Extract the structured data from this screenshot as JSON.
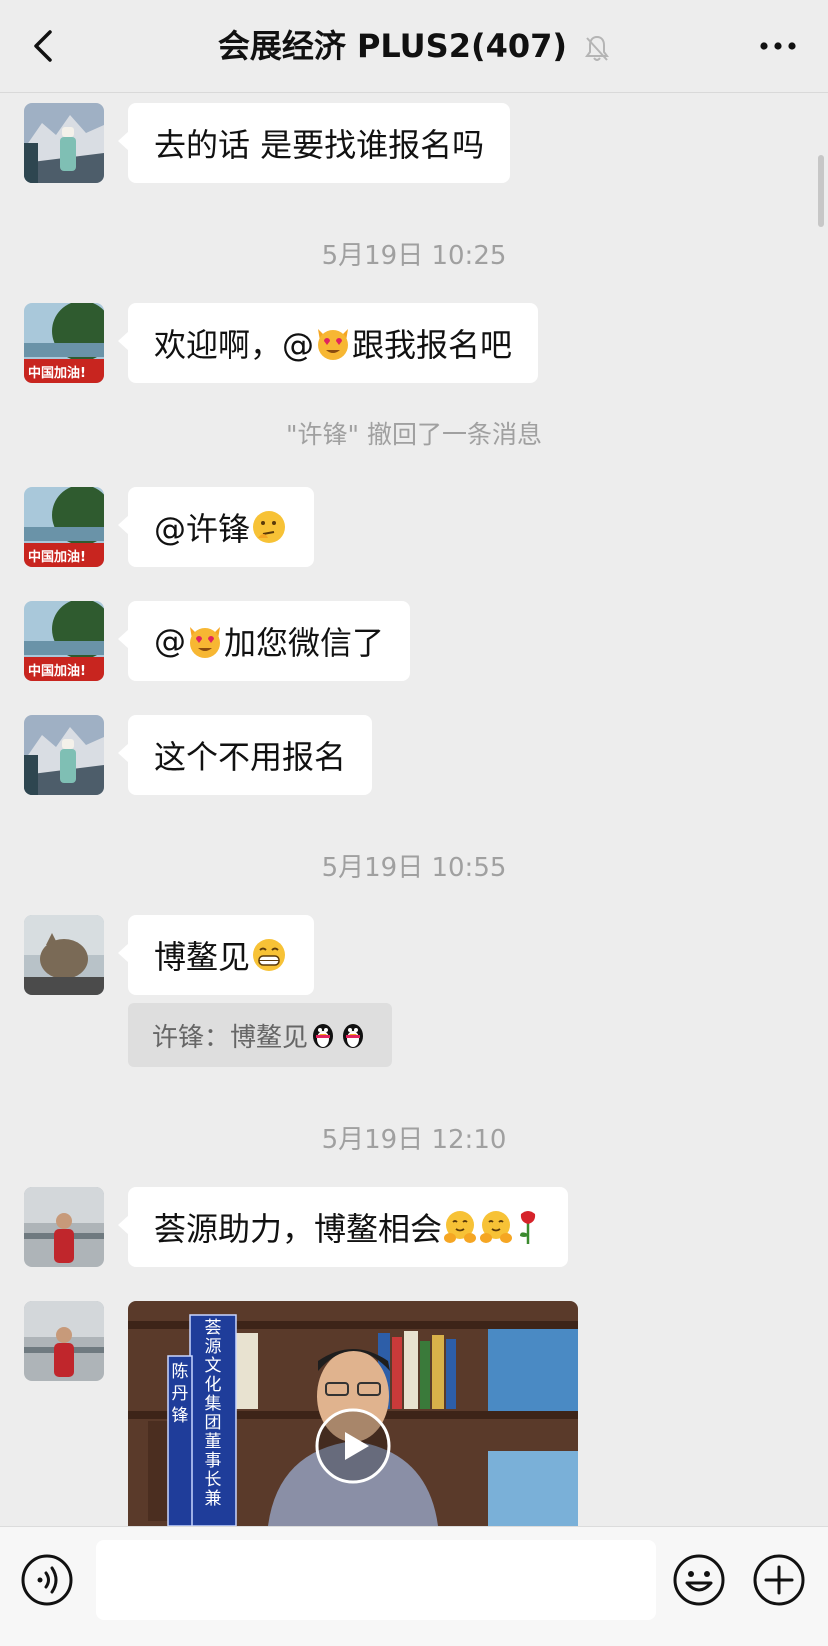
{
  "header": {
    "title": "会展经济 PLUS2(407)",
    "back_icon": "chevron-left-icon",
    "mute_icon": "bell-muted-icon",
    "more_icon": "more-icon"
  },
  "messages": [
    {
      "text": "去的话 是要找谁报名吗"
    },
    {
      "text_a": "欢迎啊，@",
      "text_b": " 跟我报名吧"
    },
    {
      "text": "@许锋 "
    },
    {
      "text_a": "@",
      "text_b": " 加您微信了"
    },
    {
      "text": "这个不用报名"
    },
    {
      "text": "博鳌见"
    },
    {
      "text": "荟源助力，博鳌相会"
    }
  ],
  "timestamps": [
    "5月19日 10:25",
    "5月19日 10:55",
    "5月19日 12:10"
  ],
  "system": {
    "recall": "\"许锋\" 撤回了一条消息"
  },
  "quote": {
    "text": "许锋：博鳌见"
  },
  "video": {
    "banner_main": [
      "荟",
      "源",
      "文",
      "化",
      "集",
      "团",
      "董",
      "事",
      "长",
      "兼"
    ],
    "banner_name": [
      "陈",
      "丹",
      "锋"
    ],
    "play_icon": "play-icon"
  },
  "input": {
    "placeholder": ""
  },
  "bottom_icons": {
    "voice": "voice-icon",
    "emoji": "smile-icon",
    "more": "plus-icon"
  }
}
